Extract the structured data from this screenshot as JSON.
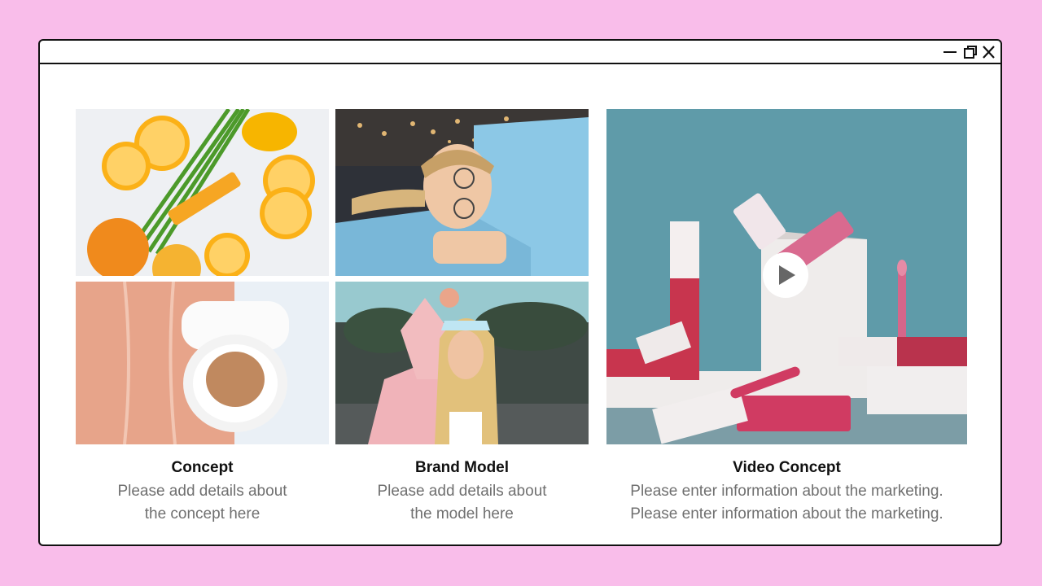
{
  "window": {
    "controls": {
      "minimize": "minimize-icon",
      "restore": "restore-icon",
      "close": "close-icon"
    }
  },
  "gallery": {
    "items": [
      {
        "title": "Concept",
        "lines": [
          "Please add details about",
          "the concept here"
        ]
      },
      {
        "title": "Brand Model",
        "lines": [
          "Please add details about",
          "the model here"
        ]
      },
      {
        "title": "Video Concept",
        "lines": [
          "Please enter information about the marketing.",
          "Please enter information about the marketing."
        ]
      }
    ],
    "video": {
      "play_icon": "play-icon"
    }
  },
  "colors": {
    "background": "#f9bdea",
    "window": "#ffffff",
    "border": "#111111",
    "caption_title": "#111111",
    "caption_text": "#707070"
  }
}
